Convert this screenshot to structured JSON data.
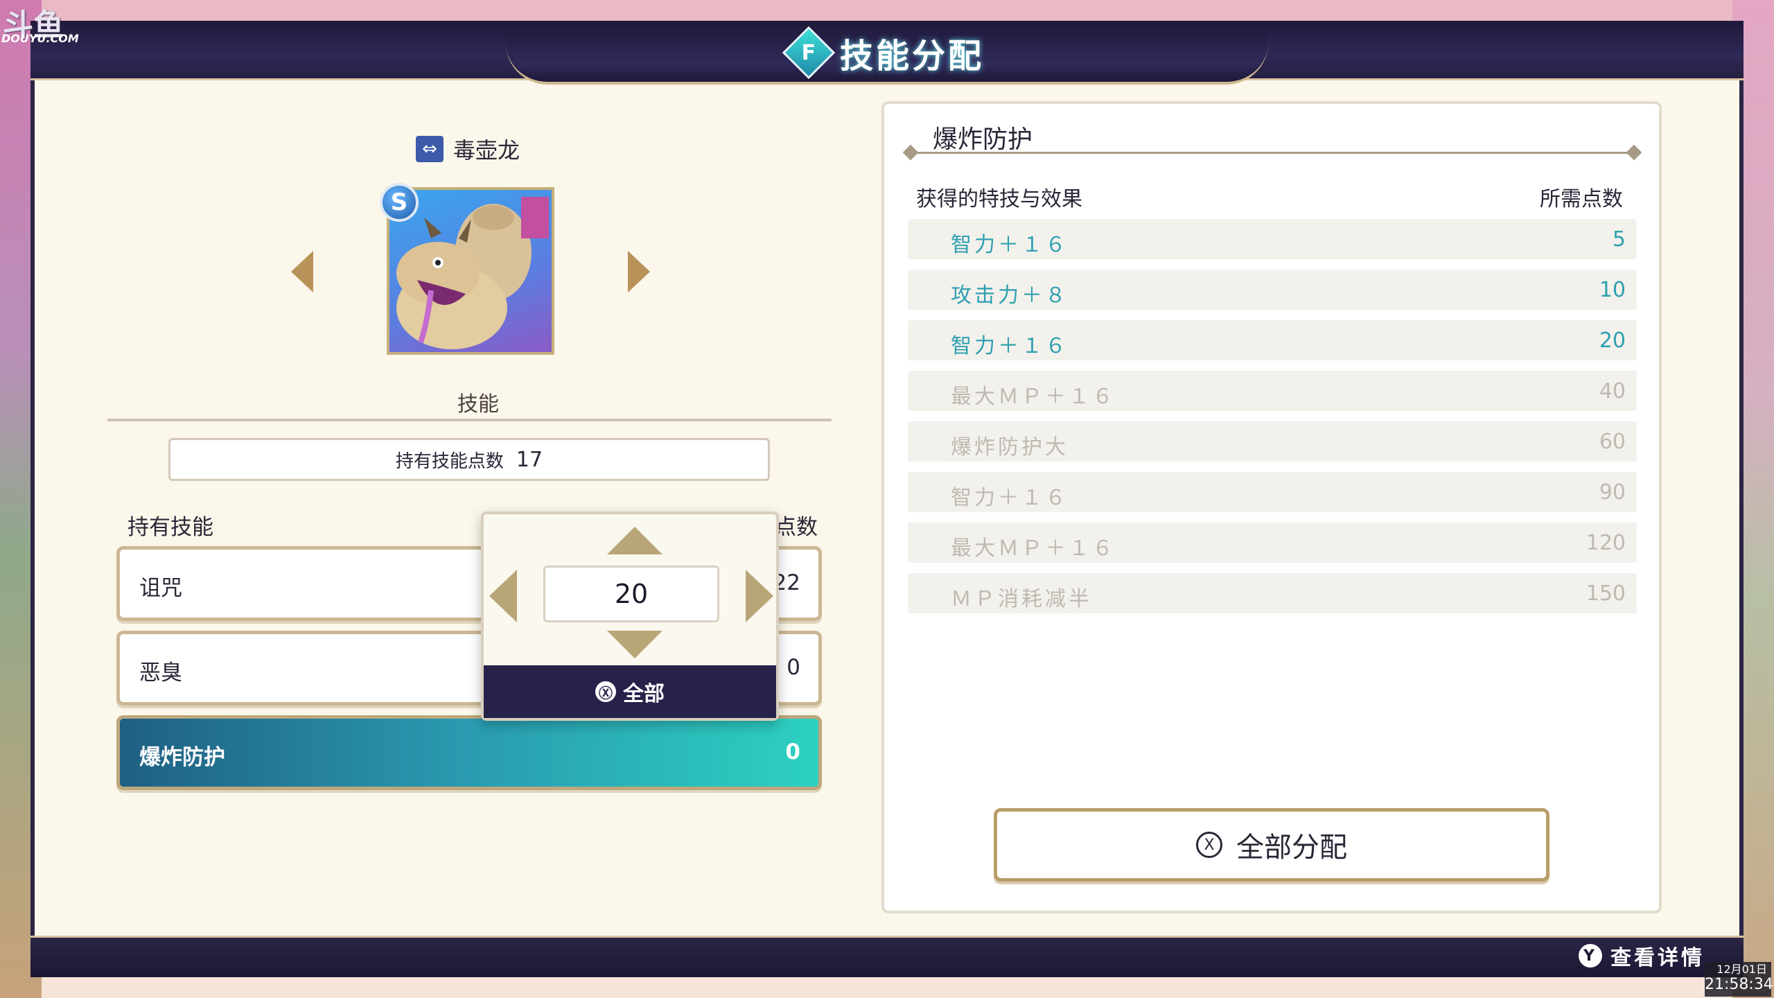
{
  "watermark": {
    "main": "斗鱼",
    "sub": "DOUYU.COM"
  },
  "header": {
    "title": "技能分配",
    "icon_glyph": "F"
  },
  "character": {
    "type_icon": "⇔",
    "name": "毒壶龙",
    "rank": "S"
  },
  "skills": {
    "section_label": "技能",
    "points_label": "持有技能点数",
    "points_value": "17",
    "owned_label": "持有技能",
    "cost_header_visible": "点数",
    "rows": [
      {
        "name": "诅咒",
        "cost": "22"
      },
      {
        "name": "恶臭",
        "cost": "0"
      },
      {
        "name": "爆炸防护",
        "cost": "0"
      }
    ]
  },
  "popup": {
    "value": "20",
    "x_glyph": "Ⓧ",
    "all_label": "全部"
  },
  "detail": {
    "title": "爆炸防护",
    "col_effect": "获得的特技与效果",
    "col_cost": "所需点数",
    "perks": [
      {
        "effect": "智力＋１６",
        "cost": "5",
        "state": "active"
      },
      {
        "effect": "攻击力＋８",
        "cost": "10",
        "state": "active"
      },
      {
        "effect": "智力＋１６",
        "cost": "20",
        "state": "active"
      },
      {
        "effect": "最大ＭＰ＋１６",
        "cost": "40",
        "state": "locked"
      },
      {
        "effect": "爆炸防护大",
        "cost": "60",
        "state": "locked"
      },
      {
        "effect": "智力＋１６",
        "cost": "90",
        "state": "locked"
      },
      {
        "effect": "最大ＭＰ＋１６",
        "cost": "120",
        "state": "locked"
      },
      {
        "effect": "ＭＰ消耗减半",
        "cost": "150",
        "state": "locked"
      }
    ],
    "assign_all_glyph": "X",
    "assign_all_label": "全部分配"
  },
  "footer": {
    "y_glyph": "Y",
    "hint": "查看详情"
  },
  "clock": {
    "date": "12月01日",
    "time": "21:58:34"
  },
  "colors": {
    "accent_teal": "#2d9fb0",
    "locked_gray": "#bdbab2",
    "frame_navy": "#2b2546",
    "gold": "#b9925a"
  }
}
